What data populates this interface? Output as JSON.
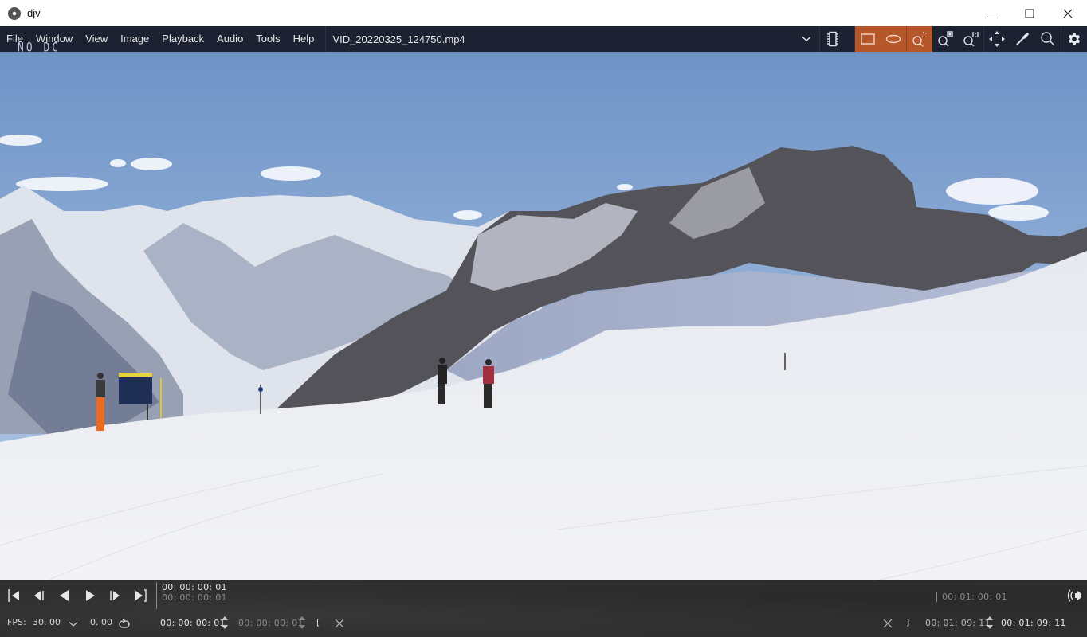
{
  "window": {
    "title": "djv",
    "controls": {
      "minimize": "minimize",
      "maximize": "maximize",
      "close": "close"
    }
  },
  "menubar": {
    "items": [
      "File",
      "Window",
      "View",
      "Image",
      "Playback",
      "Audio",
      "Tools",
      "Help"
    ],
    "current_file": "VID_20220325_124750.mp4"
  },
  "toolbar": {
    "tools": [
      {
        "icon": "file-dropdown-icon",
        "active": false
      },
      {
        "icon": "memory-cache-icon",
        "active": false
      },
      {
        "icon": "frame-view-icon",
        "active": true
      },
      {
        "icon": "fill-view-icon",
        "active": true
      },
      {
        "icon": "zoom-fit-icon",
        "active": true
      },
      {
        "icon": "zoom-reset-icon",
        "active": false
      },
      {
        "icon": "zoom-1to1-icon",
        "active": false
      },
      {
        "icon": "move-icon",
        "active": false
      },
      {
        "icon": "color-picker-icon",
        "active": false
      },
      {
        "icon": "magnify-icon",
        "active": false
      },
      {
        "icon": "settings-icon",
        "active": false
      }
    ],
    "active_color": "#b5572a"
  },
  "overlay": {
    "text": "NO DC"
  },
  "viewer": {
    "description": "Ski slope with snowy Alpine mountains, blue sky, and skiers"
  },
  "playback": {
    "buttons": [
      "go-to-start",
      "step-back",
      "play-reverse",
      "play-forward",
      "step-forward",
      "go-to-end"
    ],
    "current_time": "00: 00: 00: 01",
    "current_time_secondary": "00: 00: 00: 01",
    "timeline_marker": "00: 01: 00: 01",
    "fps_label": "FPS:",
    "fps_value": "30. 00",
    "speed_value": "0. 00",
    "in_point": "00: 00: 00: 01",
    "in_point_dim": "00: 00: 00: 01",
    "in_bracket": "[",
    "out_bracket": "]",
    "out_point": "00: 01: 09: 11",
    "duration": "00: 01: 09: 11"
  }
}
